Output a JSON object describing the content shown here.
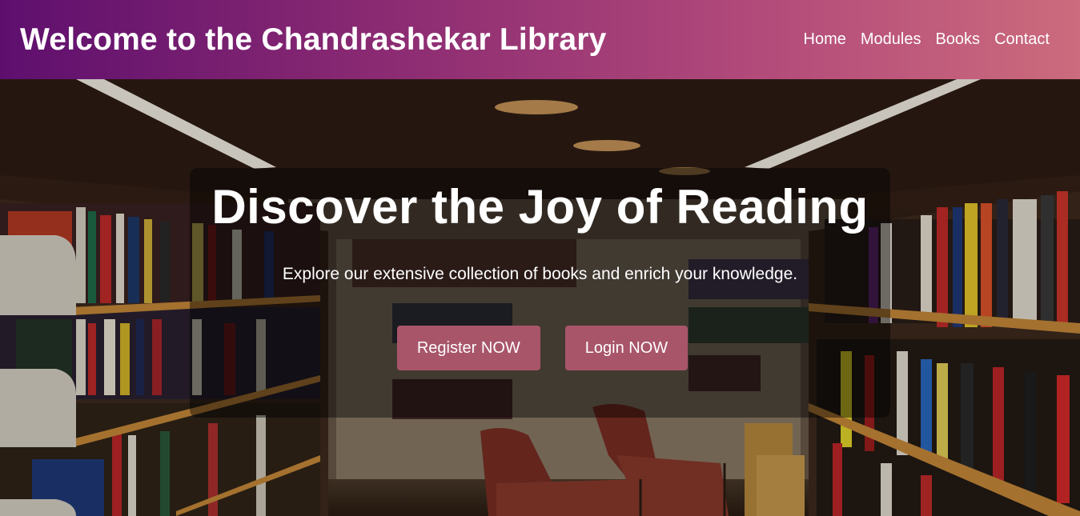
{
  "header": {
    "title": "Welcome to the Chandrashekar Library",
    "nav": [
      "Home",
      "Modules",
      "Books",
      "Contact"
    ]
  },
  "hero": {
    "title": "Discover the Joy of Reading",
    "subtitle": "Explore our extensive collection of books and enrich your knowledge.",
    "register_label": "Register NOW",
    "login_label": "Login NOW"
  },
  "colors": {
    "header_gradient_start": "#5e0f6e",
    "header_gradient_end": "#cc6b7d",
    "button_bg": "#a8556a",
    "text": "#ffffff"
  }
}
